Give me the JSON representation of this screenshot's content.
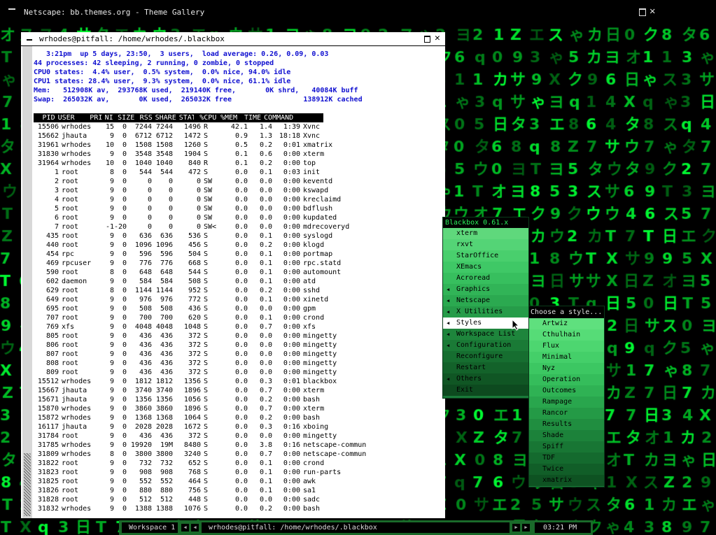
{
  "netscape": {
    "title": "Netscape: bb.themes.org - Theme Gallery"
  },
  "terminal": {
    "title": "wrhodes@pitfall: /home/wrhodes/.blackbox",
    "header_lines": [
      "   3:21pm  up 5 days, 23:50,  3 users,  load average: 0.26, 0.09, 0.03",
      "44 processes: 42 sleeping, 2 running, 0 zombie, 0 stopped",
      "CPU0 states:  4.4% user,  0.5% system,  0.0% nice, 94.0% idle",
      "CPU1 states: 28.4% user,  9.3% system,  0.0% nice, 61.1% idle",
      "Mem:   512908K av,  293768K used,  219140K free,       0K shrd,   40084K buff",
      "Swap:  265032K av,       0K used,  265032K free                 138912K cached"
    ],
    "columns": [
      "PID",
      "USER",
      "PRI",
      "NI",
      "SIZE",
      "RSS",
      "SHARE",
      "STAT",
      "%CPU",
      "%MEM",
      "TIME",
      "COMMAND"
    ],
    "processes": [
      [
        "15506",
        "wrhodes",
        "15",
        "0",
        "7244",
        "7244",
        "1496",
        "R",
        "42.1",
        "1.4",
        "1:39",
        "Xvnc"
      ],
      [
        "15662",
        "jhauta",
        "9",
        "0",
        "6712",
        "6712",
        "1472",
        "S",
        "0.9",
        "1.3",
        "18:18",
        "Xvnc"
      ],
      [
        "31961",
        "wrhodes",
        "10",
        "0",
        "1508",
        "1508",
        "1260",
        "S",
        "0.5",
        "0.2",
        "0:01",
        "xmatrix"
      ],
      [
        "31830",
        "wrhodes",
        "9",
        "0",
        "3548",
        "3548",
        "1904",
        "S",
        "0.1",
        "0.6",
        "0:00",
        "xterm"
      ],
      [
        "31964",
        "wrhodes",
        "10",
        "0",
        "1040",
        "1040",
        "840",
        "R",
        "0.1",
        "0.2",
        "0:00",
        "top"
      ],
      [
        "1",
        "root",
        "8",
        "0",
        "544",
        "544",
        "472",
        "S",
        "0.0",
        "0.1",
        "0:03",
        "init"
      ],
      [
        "2",
        "root",
        "9",
        "0",
        "0",
        "0",
        "0",
        "SW",
        "0.0",
        "0.0",
        "0:00",
        "keventd"
      ],
      [
        "3",
        "root",
        "9",
        "0",
        "0",
        "0",
        "0",
        "SW",
        "0.0",
        "0.0",
        "0:00",
        "kswapd"
      ],
      [
        "4",
        "root",
        "9",
        "0",
        "0",
        "0",
        "0",
        "SW",
        "0.0",
        "0.0",
        "0:00",
        "kreclaimd"
      ],
      [
        "5",
        "root",
        "9",
        "0",
        "0",
        "0",
        "0",
        "SW",
        "0.0",
        "0.0",
        "0:00",
        "bdflush"
      ],
      [
        "6",
        "root",
        "9",
        "0",
        "0",
        "0",
        "0",
        "SW",
        "0.0",
        "0.0",
        "0:00",
        "kupdated"
      ],
      [
        "7",
        "root",
        "-1",
        "-20",
        "0",
        "0",
        "0",
        "SW<",
        "0.0",
        "0.0",
        "0:00",
        "mdrecoveryd"
      ],
      [
        "435",
        "root",
        "9",
        "0",
        "636",
        "636",
        "536",
        "S",
        "0.0",
        "0.1",
        "0:00",
        "syslogd"
      ],
      [
        "440",
        "root",
        "9",
        "0",
        "1096",
        "1096",
        "456",
        "S",
        "0.0",
        "0.2",
        "0:00",
        "klogd"
      ],
      [
        "454",
        "rpc",
        "9",
        "0",
        "596",
        "596",
        "504",
        "S",
        "0.0",
        "0.1",
        "0:00",
        "portmap"
      ],
      [
        "469",
        "rpcuser",
        "9",
        "0",
        "776",
        "776",
        "668",
        "S",
        "0.0",
        "0.1",
        "0:00",
        "rpc.statd"
      ],
      [
        "590",
        "root",
        "8",
        "0",
        "648",
        "648",
        "544",
        "S",
        "0.0",
        "0.1",
        "0:00",
        "automount"
      ],
      [
        "602",
        "daemon",
        "9",
        "0",
        "584",
        "584",
        "508",
        "S",
        "0.0",
        "0.1",
        "0:00",
        "atd"
      ],
      [
        "629",
        "root",
        "8",
        "0",
        "1144",
        "1144",
        "952",
        "S",
        "0.0",
        "0.2",
        "0:00",
        "sshd"
      ],
      [
        "649",
        "root",
        "9",
        "0",
        "976",
        "976",
        "772",
        "S",
        "0.0",
        "0.1",
        "0:00",
        "xinetd"
      ],
      [
        "695",
        "root",
        "9",
        "0",
        "508",
        "508",
        "436",
        "S",
        "0.0",
        "0.0",
        "0:00",
        "gpm"
      ],
      [
        "707",
        "root",
        "9",
        "0",
        "700",
        "700",
        "620",
        "S",
        "0.0",
        "0.1",
        "0:00",
        "crond"
      ],
      [
        "769",
        "xfs",
        "9",
        "0",
        "4048",
        "4048",
        "1048",
        "S",
        "0.0",
        "0.7",
        "0:00",
        "xfs"
      ],
      [
        "805",
        "root",
        "9",
        "0",
        "436",
        "436",
        "372",
        "S",
        "0.0",
        "0.0",
        "0:00",
        "mingetty"
      ],
      [
        "806",
        "root",
        "9",
        "0",
        "436",
        "436",
        "372",
        "S",
        "0.0",
        "0.0",
        "0:00",
        "mingetty"
      ],
      [
        "807",
        "root",
        "9",
        "0",
        "436",
        "436",
        "372",
        "S",
        "0.0",
        "0.0",
        "0:00",
        "mingetty"
      ],
      [
        "808",
        "root",
        "9",
        "0",
        "436",
        "436",
        "372",
        "S",
        "0.0",
        "0.0",
        "0:00",
        "mingetty"
      ],
      [
        "809",
        "root",
        "9",
        "0",
        "436",
        "436",
        "372",
        "S",
        "0.0",
        "0.0",
        "0:00",
        "mingetty"
      ],
      [
        "15512",
        "wrhodes",
        "9",
        "0",
        "1812",
        "1812",
        "1356",
        "S",
        "0.0",
        "0.3",
        "0:01",
        "blackbox"
      ],
      [
        "15667",
        "jhauta",
        "9",
        "0",
        "3740",
        "3740",
        "1896",
        "S",
        "0.0",
        "0.7",
        "0:00",
        "xterm"
      ],
      [
        "15671",
        "jhauta",
        "9",
        "0",
        "1356",
        "1356",
        "1056",
        "S",
        "0.0",
        "0.2",
        "0:00",
        "bash"
      ],
      [
        "15870",
        "wrhodes",
        "9",
        "0",
        "3860",
        "3860",
        "1896",
        "S",
        "0.0",
        "0.7",
        "0:00",
        "xterm"
      ],
      [
        "15872",
        "wrhodes",
        "9",
        "0",
        "1368",
        "1368",
        "1064",
        "S",
        "0.0",
        "0.2",
        "0:00",
        "bash"
      ],
      [
        "16117",
        "jhauta",
        "9",
        "0",
        "2028",
        "2028",
        "1672",
        "S",
        "0.0",
        "0.3",
        "0:16",
        "xboing"
      ],
      [
        "31784",
        "root",
        "9",
        "0",
        "436",
        "436",
        "372",
        "S",
        "0.0",
        "0.0",
        "0:00",
        "mingetty"
      ],
      [
        "31785",
        "wrhodes",
        "9",
        "0",
        "19920",
        "19M",
        "8480",
        "S",
        "0.0",
        "3.8",
        "0:16",
        "netscape-commun"
      ],
      [
        "31809",
        "wrhodes",
        "8",
        "0",
        "3800",
        "3800",
        "3240",
        "S",
        "0.0",
        "0.7",
        "0:00",
        "netscape-commun"
      ],
      [
        "31822",
        "root",
        "9",
        "0",
        "732",
        "732",
        "652",
        "S",
        "0.0",
        "0.1",
        "0:00",
        "crond"
      ],
      [
        "31823",
        "root",
        "9",
        "0",
        "908",
        "908",
        "768",
        "S",
        "0.0",
        "0.1",
        "0:00",
        "run-parts"
      ],
      [
        "31825",
        "root",
        "9",
        "0",
        "552",
        "552",
        "464",
        "S",
        "0.0",
        "0.1",
        "0:00",
        "awk"
      ],
      [
        "31826",
        "root",
        "9",
        "0",
        "880",
        "880",
        "756",
        "S",
        "0.0",
        "0.1",
        "0:00",
        "sa1"
      ],
      [
        "31828",
        "root",
        "9",
        "0",
        "512",
        "512",
        "448",
        "S",
        "0.0",
        "0.0",
        "0:00",
        "sadc"
      ],
      [
        "31832",
        "wrhodes",
        "9",
        "0",
        "1388",
        "1388",
        "1076",
        "S",
        "0.0",
        "0.2",
        "0:00",
        "bash"
      ]
    ]
  },
  "blackbox_menu": {
    "title": "Blackbox 0.61.x",
    "items": [
      {
        "label": "xterm",
        "submenu": false,
        "color": "#5fd87c"
      },
      {
        "label": "rxvt",
        "submenu": false,
        "color": "#54d476"
      },
      {
        "label": "StarOffice",
        "submenu": false,
        "color": "#49cf6d"
      },
      {
        "label": "XEmacs",
        "submenu": false,
        "color": "#3fc866"
      },
      {
        "label": "Acroread",
        "submenu": false,
        "color": "#37bf5e"
      },
      {
        "label": "Graphics",
        "submenu": true,
        "color": "#31b457"
      },
      {
        "label": "Netscape",
        "submenu": true,
        "color": "#2ba950"
      },
      {
        "label": "X Utilities",
        "submenu": true,
        "color": "#269c49"
      },
      {
        "label": "Styles",
        "submenu": true,
        "color": "#219042",
        "selected": true
      },
      {
        "label": "Workspace List",
        "submenu": true,
        "color": "#1e853c"
      },
      {
        "label": "Configuration",
        "submenu": true,
        "color": "#1a7a36"
      },
      {
        "label": "Reconfigure",
        "submenu": false,
        "color": "#166e30"
      },
      {
        "label": "Restart",
        "submenu": false,
        "color": "#13622a"
      },
      {
        "label": "Others",
        "submenu": true,
        "color": "#105624"
      },
      {
        "label": "Exit",
        "submenu": false,
        "color": "#0d4a1f"
      }
    ]
  },
  "styles_menu": {
    "title": "Choose a style...",
    "items": [
      {
        "label": "Artwiz",
        "color": "#5fe07e"
      },
      {
        "label": "Cthulhain",
        "color": "#56dc77"
      },
      {
        "label": "Flux",
        "color": "#4dd670"
      },
      {
        "label": "Minimal",
        "color": "#44cf69"
      },
      {
        "label": "Nyz",
        "color": "#3cc762"
      },
      {
        "label": "Operation",
        "color": "#35bd5b"
      },
      {
        "label": "Outcomes",
        "color": "#2fb254"
      },
      {
        "label": "Rampage",
        "color": "#29a64d"
      },
      {
        "label": "Rancor",
        "color": "#249a46"
      },
      {
        "label": "Results",
        "color": "#208e40"
      },
      {
        "label": "Shade",
        "color": "#1c823a"
      },
      {
        "label": "Spiff",
        "color": "#187634"
      },
      {
        "label": "TDF",
        "color": "#146a2e"
      },
      {
        "label": "Twice",
        "color": "#115e28"
      },
      {
        "label": "xmatrix",
        "color": "#0e5222"
      }
    ]
  },
  "taskbar": {
    "workspace": "Workspace 1",
    "window": "wrhodes@pitfall: /home/wrhodes/.blackbox",
    "clock": "03:21 PM"
  },
  "colors": {
    "matrix_green": "#1fd53a",
    "menu_text": "#000000",
    "taskbar_green": "#1a6a2a"
  }
}
